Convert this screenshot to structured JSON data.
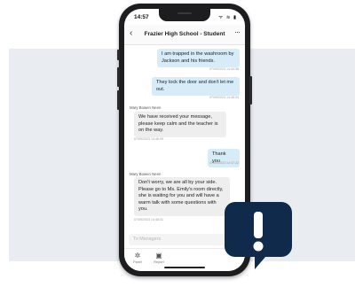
{
  "status_bar": {
    "time": "14:57",
    "icons": "ᯤ ≋ ▮"
  },
  "header": {
    "back": "‹",
    "title": "Frazier High School - Student",
    "more": "···"
  },
  "messages": [
    {
      "text": "I am trapped in the washroom by Jackson and his friends.",
      "time": "07/09/2023 14:44:36"
    },
    {
      "text": "They lock the door and don't let me out.",
      "time": "07/09/2023 14:45:04"
    },
    {
      "sender": "Mary Bowen Neen",
      "text": "We have received your message, please keep calm and the teacher is on the way.",
      "time": "07/09/2023 14:46:09"
    },
    {
      "text": "Thank you",
      "time": "07/09/2023 14:47:22"
    },
    {
      "sender": "Mary Bowen Neen",
      "text": "Don't worry, we are all by your side. Please go to Ms. Emily's room directly, she is waiting for you and will have a warm talk with some questions with you.",
      "time": "07/09/2023 14:48:31"
    }
  ],
  "composer": {
    "placeholder": "To Managers"
  },
  "tabs": [
    {
      "label": "Panel"
    },
    {
      "label": "Report"
    }
  ],
  "colors": {
    "outgoing_bubble": "#d6ecf8",
    "incoming_bubble": "#eeeeee",
    "alert_badge": "#0f2a4a"
  },
  "alert_icon": "exclamation-speech-icon"
}
